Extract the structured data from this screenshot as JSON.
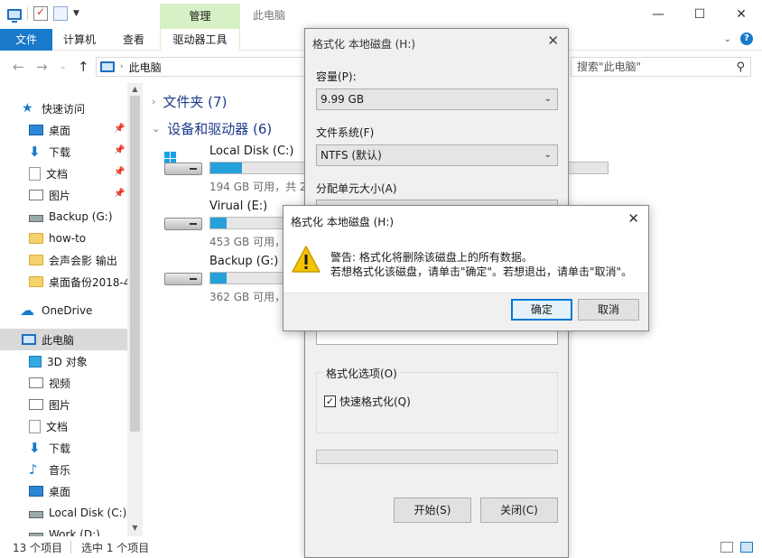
{
  "explorer": {
    "title": "此电脑",
    "context_tab": "管理",
    "ribbon_tabs": {
      "file": "文件",
      "computer": "计算机",
      "view": "查看",
      "drive_tools": "驱动器工具"
    },
    "address": "此电脑",
    "search_placeholder": "搜索\"此电脑\"",
    "sidebar": [
      {
        "label": "快速访问",
        "icon": "star-icon"
      },
      {
        "label": "桌面",
        "icon": "desktop-icon"
      },
      {
        "label": "下载",
        "icon": "download-icon"
      },
      {
        "label": "文档",
        "icon": "document-icon"
      },
      {
        "label": "图片",
        "icon": "picture-icon"
      },
      {
        "label": "Backup (G:)",
        "icon": "drive-icon"
      },
      {
        "label": "how-to",
        "icon": "folder-icon"
      },
      {
        "label": "会声会影 输出",
        "icon": "folder-icon"
      },
      {
        "label": "桌面备份2018-4",
        "icon": "folder-icon"
      },
      {
        "label": "OneDrive",
        "icon": "cloud-icon"
      },
      {
        "label": "此电脑",
        "icon": "pc-icon"
      },
      {
        "label": "3D 对象",
        "icon": "cube-icon"
      },
      {
        "label": "视频",
        "icon": "video-icon"
      },
      {
        "label": "图片",
        "icon": "picture-icon"
      },
      {
        "label": "文档",
        "icon": "document-icon"
      },
      {
        "label": "下载",
        "icon": "download-icon"
      },
      {
        "label": "音乐",
        "icon": "music-icon"
      },
      {
        "label": "桌面",
        "icon": "desktop-icon"
      },
      {
        "label": "Local Disk (C:)",
        "icon": "drive-icon"
      },
      {
        "label": "Work (D:)",
        "icon": "drive-icon"
      }
    ],
    "groups": {
      "folders": "文件夹 (7)",
      "devices": "设备和驱动器 (6)"
    },
    "drives": [
      {
        "name": "Local Disk (C:)",
        "free": "194 GB 可用，共 2",
        "usage": 0.08
      },
      {
        "name": "Virual (E:)",
        "free": "453 GB 可用，",
        "usage": 0.04
      },
      {
        "name": "Backup (G:)",
        "free": "362 GB 可用，",
        "usage": 0.04
      }
    ],
    "status": {
      "count": "13 个项目",
      "selected": "选中 1 个项目"
    }
  },
  "format_dialog": {
    "title": "格式化 本地磁盘 (H:)",
    "capacity_label": "容量(P):",
    "capacity_value": "9.99 GB",
    "fs_label": "文件系统(F)",
    "fs_value": "NTFS (默认)",
    "alloc_label": "分配单元大小(A)",
    "options_label": "格式化选项(O)",
    "quick_format": "快速格式化(Q)",
    "quick_format_checked": true,
    "start": "开始(S)",
    "close": "关闭(C)"
  },
  "warning_dialog": {
    "title": "格式化 本地磁盘 (H:)",
    "line1": "警告: 格式化将删除该磁盘上的所有数据。",
    "line2": "若想格式化该磁盘，请单击\"确定\"。若想退出，请单击\"取消\"。",
    "ok": "确定",
    "cancel": "取消"
  },
  "colors": {
    "accent": "#1979ca",
    "manage_tab": "#d8f0c6",
    "progress": "#26a0da",
    "warning": "#f4c400"
  }
}
